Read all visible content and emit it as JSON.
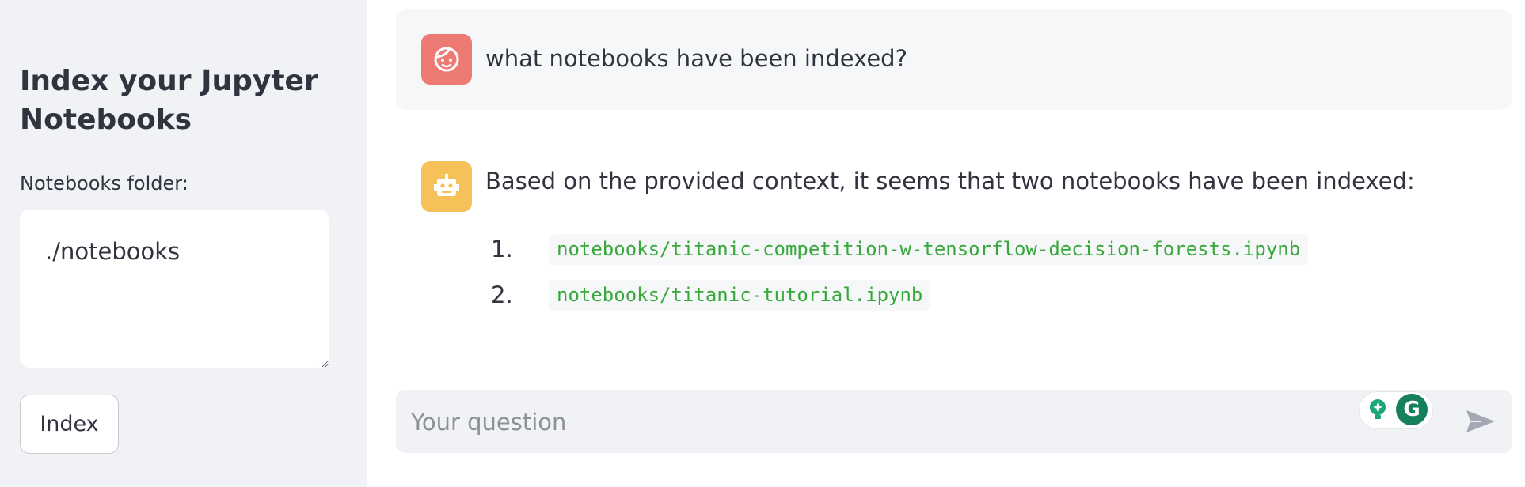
{
  "sidebar": {
    "title": "Index your Jupyter Notebooks",
    "folder_label": "Notebooks folder:",
    "folder_value": "./notebooks",
    "index_button": "Index"
  },
  "chat": {
    "messages": [
      {
        "role": "user",
        "avatar_icon": "face-icon",
        "text": "what notebooks have been indexed?"
      },
      {
        "role": "assistant",
        "avatar_icon": "robot-icon",
        "text": "Based on the provided context, it seems that two notebooks have been indexed:",
        "list": [
          {
            "num": "1.",
            "code": "notebooks/titanic-competition-w-tensorflow-decision-forests.ipynb"
          },
          {
            "num": "2.",
            "code": "notebooks/titanic-tutorial.ipynb"
          }
        ]
      }
    ],
    "input_placeholder": "Your question",
    "send_icon": "send-icon",
    "grammarly_logo_letter": "G"
  },
  "colors": {
    "sidebar_bg": "#f0f2f6",
    "user_avatar": "#ee7a74",
    "assistant_avatar": "#f7c15a",
    "code_text": "#38a83b",
    "grammarly": "#15805d"
  }
}
